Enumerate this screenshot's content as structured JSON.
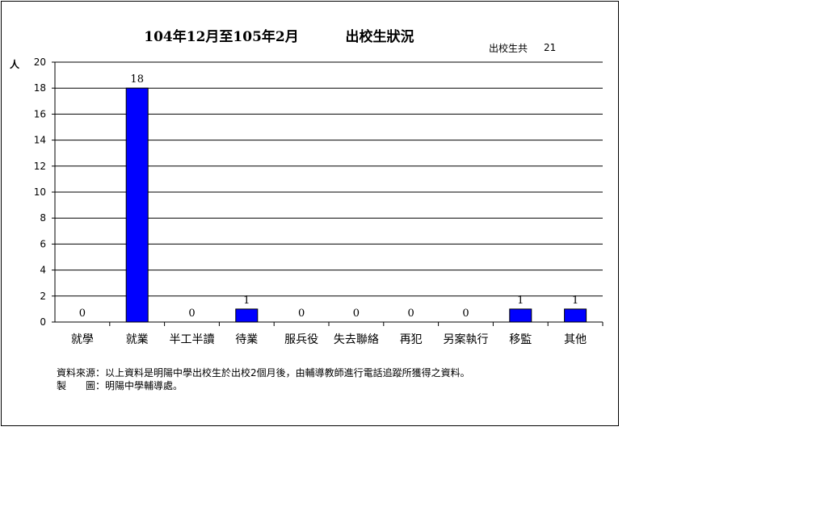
{
  "chart_data": {
    "type": "bar",
    "title": "104年12月至105年2月",
    "title2": "出校生狀況",
    "total_label": "出校生共",
    "total_value": "21",
    "ylabel": "人",
    "ylim": [
      0,
      20
    ],
    "yticks": [
      0,
      2,
      4,
      6,
      8,
      10,
      12,
      14,
      16,
      18,
      20
    ],
    "categories": [
      "就學",
      "就業",
      "半工半讀",
      "待業",
      "服兵役",
      "失去聯絡",
      "再犯",
      "另案執行",
      "移監",
      "其他"
    ],
    "values": [
      0,
      18,
      0,
      1,
      0,
      0,
      0,
      0,
      1,
      1
    ],
    "bar_color": "#0000FF",
    "grid": true
  },
  "notes": {
    "source": "資料來源：以上資料是明陽中學出校生於出校2個月後，由輔導教師進行電話追蹤所獲得之資料。",
    "maker": "製　　圖：明陽中學輔導處。"
  }
}
